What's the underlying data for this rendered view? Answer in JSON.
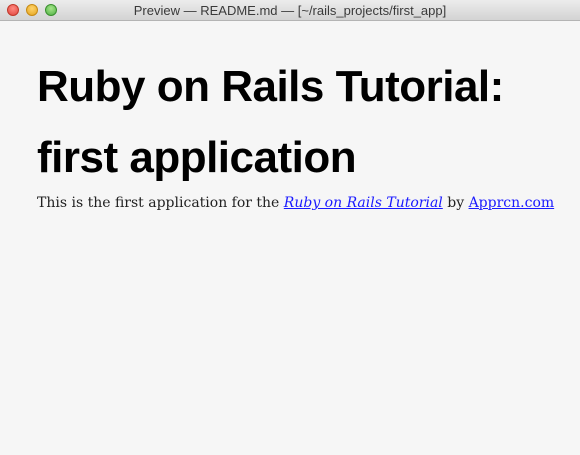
{
  "window": {
    "title": "Preview — README.md — [~/rails_projects/first_app]"
  },
  "document": {
    "heading": "Ruby on Rails Tutorial: first application",
    "paragraph": {
      "prefix": "This is the first application for the ",
      "tutorial_link": "Ruby on Rails Tutorial",
      "middle": " by ",
      "author_link": "Apprcn.com"
    }
  },
  "colors": {
    "link": "#1a1aff",
    "close": "#e0443e",
    "minimize": "#e3a51f",
    "zoom": "#4eb043"
  }
}
